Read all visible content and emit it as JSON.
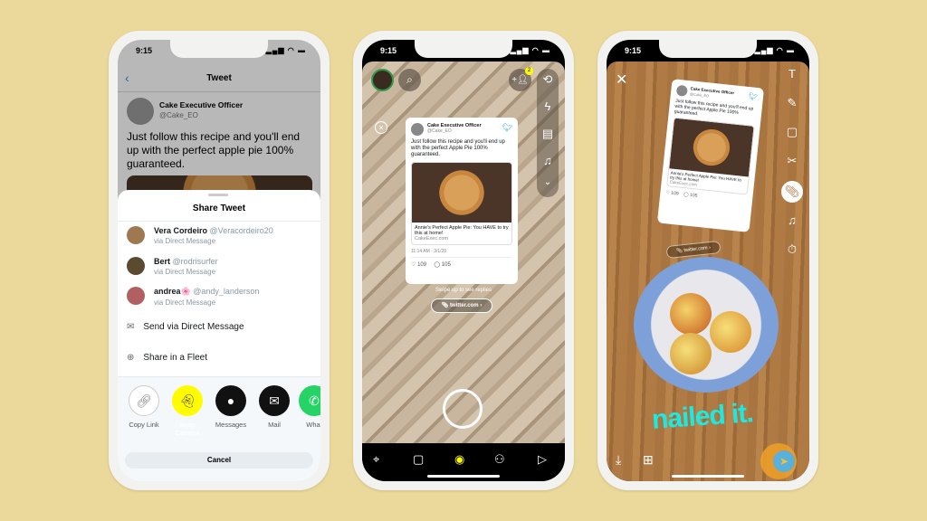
{
  "status_time": "9:15",
  "phone1": {
    "header_title": "Tweet",
    "tweet": {
      "author": "Cake Executive Officer",
      "handle": "@Cake_EO",
      "text": "Just follow this recipe and you'll end up with the perfect apple pie 100% guaranteed."
    },
    "sheet_title": "Share Tweet",
    "contacts": [
      {
        "name": "Vera Cordeiro",
        "handle": "@Veracordeiro20",
        "via": "via Direct Message"
      },
      {
        "name": "Bert",
        "handle": "@rodrisurfer",
        "via": "via Direct Message"
      },
      {
        "name": "andrea🌸",
        "handle": "@andy_landerson",
        "via": "via Direct Message"
      }
    ],
    "actions": [
      {
        "label": "Send via Direct Message",
        "icon": "mail-icon"
      },
      {
        "label": "Share in a Fleet",
        "icon": "plus-circle-icon"
      }
    ],
    "apps": [
      {
        "label": "Copy Link"
      },
      {
        "label": "Snap Camera"
      },
      {
        "label": "Messages"
      },
      {
        "label": "Mail"
      },
      {
        "label": "What"
      }
    ],
    "cancel": "Cancel"
  },
  "card": {
    "author": "Cake Executive Officer",
    "handle": "@Cake_EO",
    "text": "Just follow this recipe and you'll end up with the perfect Apple Pie 100% guaranteed.",
    "link_title": "Annie's Perfect Apple Pie: You HAVE to try this at home!",
    "link_domain": "CakeExec.com",
    "time": "11:14 AM · 3/1/20",
    "likes": "109",
    "replies": "105",
    "swipe": "Swipe up to see replies",
    "attachment": "twitter.com"
  },
  "phone2": {
    "friend_badge": "2"
  },
  "phone3": {
    "caption": "nailed it."
  },
  "colors": {
    "background": "#ebd99c",
    "twitter_blue": "#1da1f2",
    "snap_yellow": "#fffc00",
    "caption": "#1de9e0"
  }
}
